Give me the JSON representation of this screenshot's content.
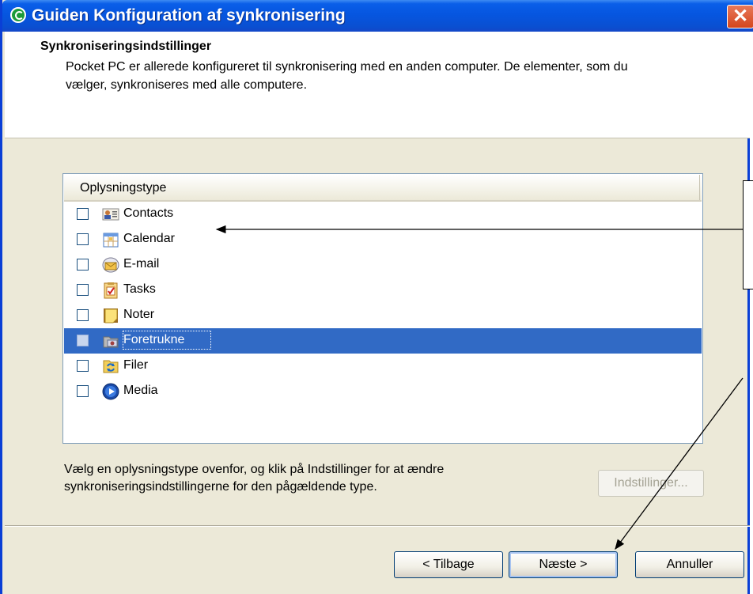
{
  "window": {
    "title": "Guiden Konfiguration af synkronisering",
    "close_glyph": "✕"
  },
  "header": {
    "title": "Synkroniseringsindstillinger",
    "description": "Pocket PC er allerede konfigureret til synkronisering med en anden computer. De elementer, som du vælger, synkroniseres med alle computere."
  },
  "list": {
    "column_header": "Oplysningstype",
    "items": [
      {
        "label": "Contacts",
        "icon": "contacts-icon",
        "checked": false,
        "selected": false
      },
      {
        "label": "Calendar",
        "icon": "calendar-icon",
        "checked": false,
        "selected": false
      },
      {
        "label": "E-mail",
        "icon": "email-icon",
        "checked": false,
        "selected": false
      },
      {
        "label": "Tasks",
        "icon": "tasks-icon",
        "checked": false,
        "selected": false
      },
      {
        "label": "Noter",
        "icon": "notes-icon",
        "checked": false,
        "selected": false
      },
      {
        "label": "Foretrukne",
        "icon": "favorites-icon",
        "checked": false,
        "selected": true
      },
      {
        "label": "Filer",
        "icon": "files-icon",
        "checked": false,
        "selected": false
      },
      {
        "label": "Media",
        "icon": "media-icon",
        "checked": false,
        "selected": false
      }
    ]
  },
  "hint": "Vælg en oplysningstype ovenfor, og klik på Indstillinger for at ændre synkroniseringsindstillingerne for den pågældende type.",
  "buttons": {
    "settings": "Indstillinger...",
    "back": "< Tilbage",
    "next": "Næste >",
    "cancel": "Annuller"
  },
  "colors": {
    "titlebar": "#0a5ee8",
    "selection": "#316ac5",
    "dialog_bg": "#ece9d8"
  }
}
